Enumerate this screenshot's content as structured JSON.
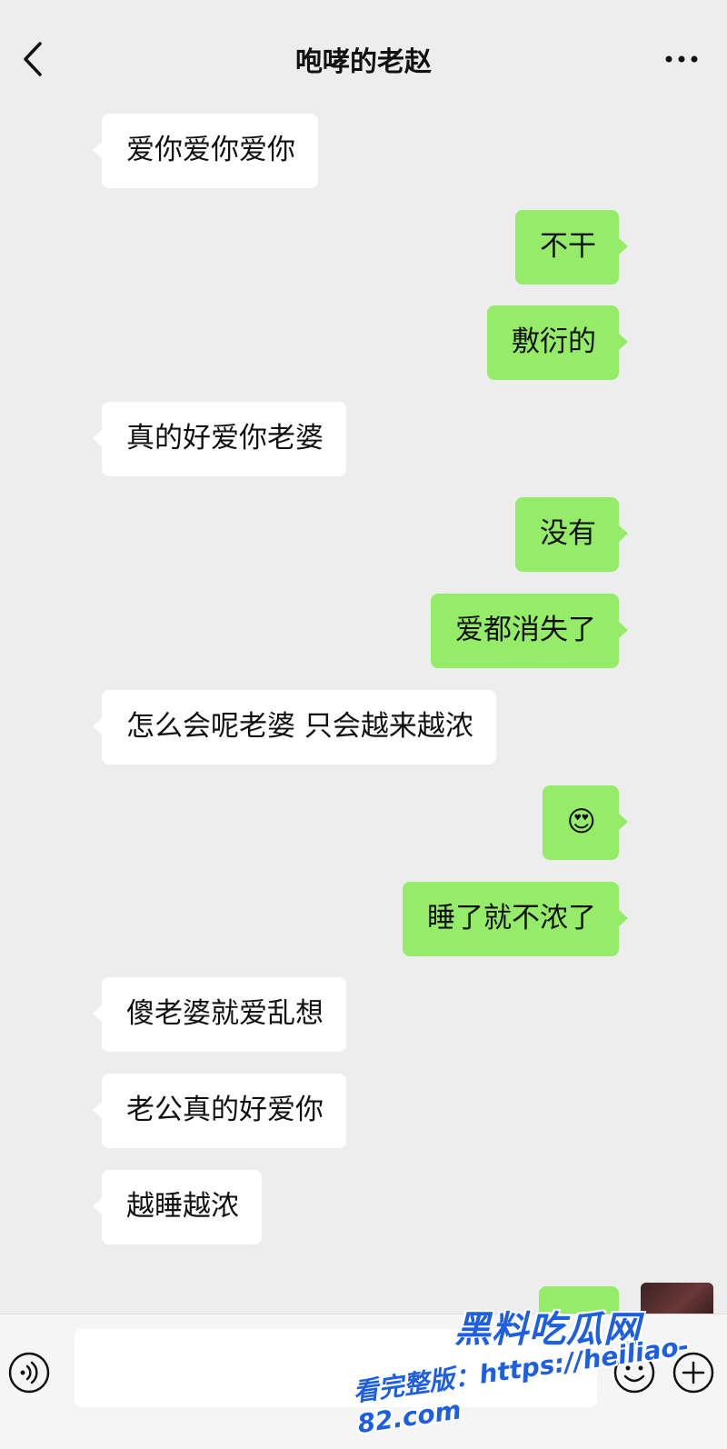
{
  "header": {
    "title": "咆哮的老赵",
    "back_icon": "chevron-left-icon",
    "more_icon": "more-dots-icon"
  },
  "messages": [
    {
      "side": "left",
      "text": "爱你爱你爱你"
    },
    {
      "side": "right",
      "text": "不干"
    },
    {
      "side": "right",
      "text": "敷衍的"
    },
    {
      "side": "left",
      "text": "真的好爱你老婆"
    },
    {
      "side": "right",
      "text": "没有"
    },
    {
      "side": "right",
      "text": "爱都消失了"
    },
    {
      "side": "left",
      "text": "怎么会呢老婆 只会越来越浓"
    },
    {
      "side": "right",
      "text": "😍"
    },
    {
      "side": "right",
      "text": "睡了就不浓了"
    },
    {
      "side": "left",
      "text": "傻老婆就爱乱想"
    },
    {
      "side": "left",
      "text": "老公真的好爱你"
    },
    {
      "side": "left",
      "text": "越睡越浓"
    }
  ],
  "input_bar": {
    "voice_icon": "voice-icon",
    "input_value": "",
    "emoji_icon": "emoji-icon",
    "plus_icon": "plus-icon"
  },
  "watermark": {
    "title": "黑料吃瓜网",
    "url": "看完整版：https://heiliao-82.com"
  },
  "colors": {
    "background": "#ededed",
    "sent_bubble": "#95ec69",
    "received_bubble": "#ffffff"
  }
}
